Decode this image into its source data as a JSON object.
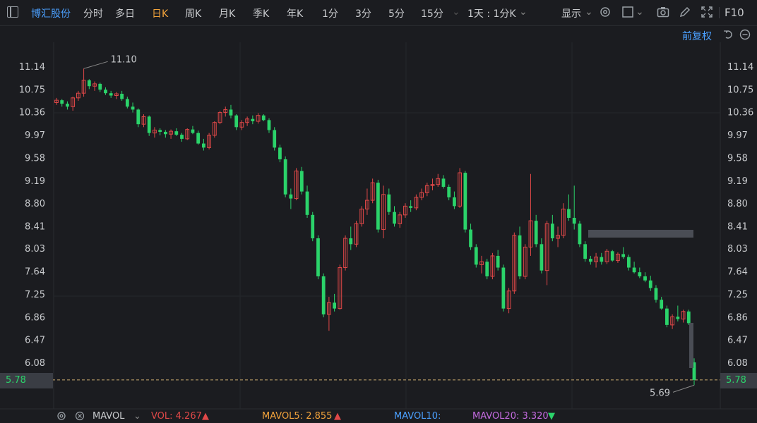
{
  "toolbar": {
    "stock_name": "博汇股份",
    "periods": [
      "分时",
      "多日",
      "日K",
      "周K",
      "月K",
      "季K",
      "年K",
      "1分",
      "3分",
      "5分",
      "15分"
    ],
    "active_period": "日K",
    "multi_period": "1天 : 1分K",
    "display_label": "显示",
    "f10_label": "F10",
    "icons": [
      "sidebar-icon",
      "chevron-down-icon",
      "gear-icon",
      "square-icon",
      "chevron-down-icon",
      "camera-icon",
      "pencil-icon",
      "expand-icon"
    ]
  },
  "adjust_label": "前复权",
  "right_icons": [
    "undo-icon",
    "minus-circle-icon"
  ],
  "price_axis": {
    "ticks": [
      "11.14",
      "10.75",
      "10.36",
      "9.97",
      "9.58",
      "9.19",
      "8.80",
      "8.41",
      "8.03",
      "7.64",
      "7.25",
      "6.86",
      "6.47",
      "6.08"
    ],
    "current_price": "5.78"
  },
  "annotations": {
    "high_label": "11.10",
    "low_label": "5.69"
  },
  "bottom_bar": {
    "indicator": "MAVOL",
    "vol": "VOL: 4.267",
    "mavol5": "MAVOL5: 2.855",
    "mavol10": "MAVOL10:",
    "mavol20": "MAVOL20: 3.320"
  },
  "colors": {
    "up": "#e04848",
    "down": "#2bd36a",
    "accent": "#f2a33b",
    "link": "#4ba0ff",
    "mavol5": "#f2a33b",
    "mavol10": "#4ba0ff",
    "mavol20": "#c36adf"
  },
  "chart_data": {
    "type": "candlestick",
    "y_range": [
      5.69,
      11.1
    ],
    "ohlc": [
      [
        10.52,
        10.6,
        10.48,
        10.56
      ],
      [
        10.56,
        10.58,
        10.45,
        10.5
      ],
      [
        10.5,
        10.54,
        10.4,
        10.45
      ],
      [
        10.45,
        10.62,
        10.38,
        10.6
      ],
      [
        10.6,
        10.72,
        10.55,
        10.68
      ],
      [
        10.68,
        11.1,
        10.62,
        10.9
      ],
      [
        10.9,
        10.92,
        10.75,
        10.8
      ],
      [
        10.8,
        10.88,
        10.72,
        10.84
      ],
      [
        10.84,
        10.86,
        10.7,
        10.74
      ],
      [
        10.74,
        10.78,
        10.65,
        10.68
      ],
      [
        10.68,
        10.72,
        10.6,
        10.64
      ],
      [
        10.64,
        10.7,
        10.58,
        10.67
      ],
      [
        10.67,
        10.72,
        10.55,
        10.58
      ],
      [
        10.58,
        10.62,
        10.42,
        10.45
      ],
      [
        10.45,
        10.52,
        10.35,
        10.4
      ],
      [
        10.4,
        10.42,
        10.1,
        10.15
      ],
      [
        10.15,
        10.32,
        10.1,
        10.28
      ],
      [
        10.28,
        10.3,
        9.95,
        10.0
      ],
      [
        10.0,
        10.1,
        9.92,
        10.05
      ],
      [
        10.05,
        10.08,
        9.96,
        10.02
      ],
      [
        10.02,
        10.05,
        9.92,
        9.98
      ],
      [
        9.98,
        10.06,
        9.9,
        10.03
      ],
      [
        10.03,
        10.08,
        9.95,
        9.97
      ],
      [
        9.97,
        10.0,
        9.85,
        9.9
      ],
      [
        9.9,
        10.08,
        9.88,
        10.06
      ],
      [
        10.06,
        10.12,
        9.98,
        10.0
      ],
      [
        10.0,
        10.04,
        9.8,
        9.82
      ],
      [
        9.82,
        9.9,
        9.7,
        9.75
      ],
      [
        9.75,
        10.0,
        9.72,
        9.96
      ],
      [
        9.96,
        10.2,
        9.92,
        10.18
      ],
      [
        10.18,
        10.38,
        10.15,
        10.35
      ],
      [
        10.35,
        10.45,
        10.28,
        10.4
      ],
      [
        10.4,
        10.48,
        10.25,
        10.3
      ],
      [
        10.3,
        10.32,
        10.05,
        10.1
      ],
      [
        10.1,
        10.22,
        10.05,
        10.18
      ],
      [
        10.18,
        10.28,
        10.12,
        10.24
      ],
      [
        10.24,
        10.3,
        10.15,
        10.2
      ],
      [
        10.2,
        10.34,
        10.16,
        10.3
      ],
      [
        10.3,
        10.32,
        10.2,
        10.22
      ],
      [
        10.22,
        10.25,
        10.0,
        10.05
      ],
      [
        10.05,
        10.1,
        9.7,
        9.75
      ],
      [
        9.75,
        9.8,
        9.5,
        9.55
      ],
      [
        9.55,
        9.6,
        8.9,
        8.95
      ],
      [
        8.95,
        9.05,
        8.7,
        8.88
      ],
      [
        8.88,
        9.4,
        8.85,
        9.35
      ],
      [
        9.35,
        9.42,
        8.95,
        9.0
      ],
      [
        9.0,
        9.1,
        8.55,
        8.6
      ],
      [
        8.6,
        8.65,
        8.15,
        8.2
      ],
      [
        8.2,
        8.25,
        7.5,
        7.55
      ],
      [
        7.55,
        7.6,
        6.85,
        6.9
      ],
      [
        6.9,
        7.2,
        6.62,
        7.1
      ],
      [
        7.1,
        7.25,
        6.95,
        7.0
      ],
      [
        7.0,
        7.75,
        6.98,
        7.7
      ],
      [
        7.7,
        8.25,
        7.65,
        8.2
      ],
      [
        8.2,
        8.4,
        8.0,
        8.1
      ],
      [
        8.1,
        8.5,
        8.05,
        8.45
      ],
      [
        8.45,
        8.75,
        8.4,
        8.7
      ],
      [
        8.7,
        9.05,
        8.6,
        8.85
      ],
      [
        8.85,
        9.22,
        8.8,
        9.15
      ],
      [
        9.15,
        9.2,
        8.3,
        8.35
      ],
      [
        8.35,
        9.1,
        8.2,
        8.95
      ],
      [
        8.95,
        9.05,
        8.6,
        8.65
      ],
      [
        8.65,
        8.75,
        8.4,
        8.45
      ],
      [
        8.45,
        8.65,
        8.38,
        8.6
      ],
      [
        8.6,
        8.8,
        8.55,
        8.75
      ],
      [
        8.75,
        8.85,
        8.65,
        8.72
      ],
      [
        8.72,
        8.95,
        8.68,
        8.9
      ],
      [
        8.9,
        9.05,
        8.85,
        8.98
      ],
      [
        8.98,
        9.15,
        8.92,
        9.1
      ],
      [
        9.1,
        9.22,
        9.02,
        9.12
      ],
      [
        9.12,
        9.3,
        9.08,
        9.22
      ],
      [
        9.22,
        9.28,
        9.05,
        9.08
      ],
      [
        9.08,
        9.12,
        8.85,
        8.9
      ],
      [
        8.9,
        9.0,
        8.7,
        8.75
      ],
      [
        8.75,
        9.4,
        8.72,
        9.32
      ],
      [
        9.32,
        9.35,
        8.3,
        8.35
      ],
      [
        8.35,
        8.45,
        8.0,
        8.05
      ],
      [
        8.05,
        8.1,
        7.7,
        7.75
      ],
      [
        7.75,
        7.9,
        7.6,
        7.8
      ],
      [
        7.8,
        7.85,
        7.5,
        7.55
      ],
      [
        7.55,
        7.95,
        7.5,
        7.9
      ],
      [
        7.9,
        8.0,
        7.65,
        7.7
      ],
      [
        7.7,
        7.75,
        6.95,
        7.0
      ],
      [
        7.0,
        7.35,
        6.92,
        7.3
      ],
      [
        7.3,
        8.3,
        7.25,
        8.25
      ],
      [
        8.25,
        8.4,
        7.5,
        7.55
      ],
      [
        7.55,
        8.1,
        7.5,
        8.05
      ],
      [
        8.05,
        9.3,
        7.9,
        8.5
      ],
      [
        8.5,
        8.6,
        8.05,
        8.1
      ],
      [
        8.1,
        8.2,
        7.6,
        7.65
      ],
      [
        7.65,
        8.5,
        7.4,
        8.45
      ],
      [
        8.45,
        8.6,
        8.15,
        8.2
      ],
      [
        8.2,
        8.4,
        8.05,
        8.25
      ],
      [
        8.25,
        8.8,
        8.2,
        8.7
      ],
      [
        8.7,
        8.95,
        8.5,
        8.55
      ],
      [
        8.55,
        9.1,
        8.35,
        8.45
      ],
      [
        8.45,
        8.5,
        8.05,
        8.1
      ],
      [
        8.1,
        8.15,
        7.8,
        7.85
      ],
      [
        7.85,
        7.9,
        7.75,
        7.8
      ],
      [
        7.8,
        7.95,
        7.7,
        7.88
      ],
      [
        7.88,
        7.95,
        7.75,
        7.8
      ],
      [
        7.8,
        8.02,
        7.76,
        7.98
      ],
      [
        7.98,
        8.0,
        7.8,
        7.82
      ],
      [
        7.82,
        7.96,
        7.78,
        7.93
      ],
      [
        7.93,
        8.05,
        7.85,
        7.88
      ],
      [
        7.88,
        7.92,
        7.65,
        7.7
      ],
      [
        7.7,
        7.8,
        7.6,
        7.62
      ],
      [
        7.62,
        7.7,
        7.52,
        7.55
      ],
      [
        7.55,
        7.62,
        7.45,
        7.48
      ],
      [
        7.48,
        7.56,
        7.3,
        7.35
      ],
      [
        7.35,
        7.4,
        7.1,
        7.15
      ],
      [
        7.15,
        7.2,
        6.98,
        7.0
      ],
      [
        7.0,
        7.05,
        6.68,
        6.72
      ],
      [
        6.72,
        6.9,
        6.65,
        6.86
      ],
      [
        6.86,
        7.05,
        6.78,
        6.82
      ],
      [
        6.82,
        6.98,
        6.76,
        6.95
      ],
      [
        6.95,
        6.98,
        6.72,
        6.75
      ],
      [
        6.08,
        6.15,
        5.69,
        5.78
      ]
    ]
  }
}
